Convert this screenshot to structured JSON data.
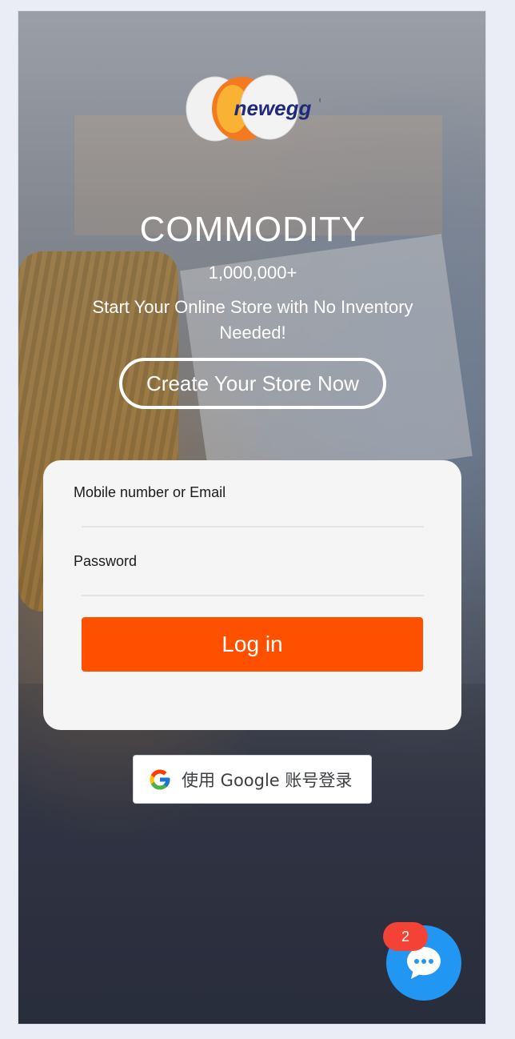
{
  "hero": {
    "title": "COMMODITY",
    "count": "1,000,000+",
    "tagline": "Start Your Online Store with No Inventory Needed!",
    "create_button": "Create Your Store Now"
  },
  "logo": {
    "text": "newegg"
  },
  "login": {
    "email_label": "Mobile number or Email",
    "password_label": "Password",
    "login_button": "Log in"
  },
  "google": {
    "label": "使用 Google 账号登录"
  },
  "chat": {
    "badge_count": "2"
  },
  "colors": {
    "primary": "#ff5000",
    "chat_fab": "#2196f3",
    "badge": "#f44336"
  }
}
